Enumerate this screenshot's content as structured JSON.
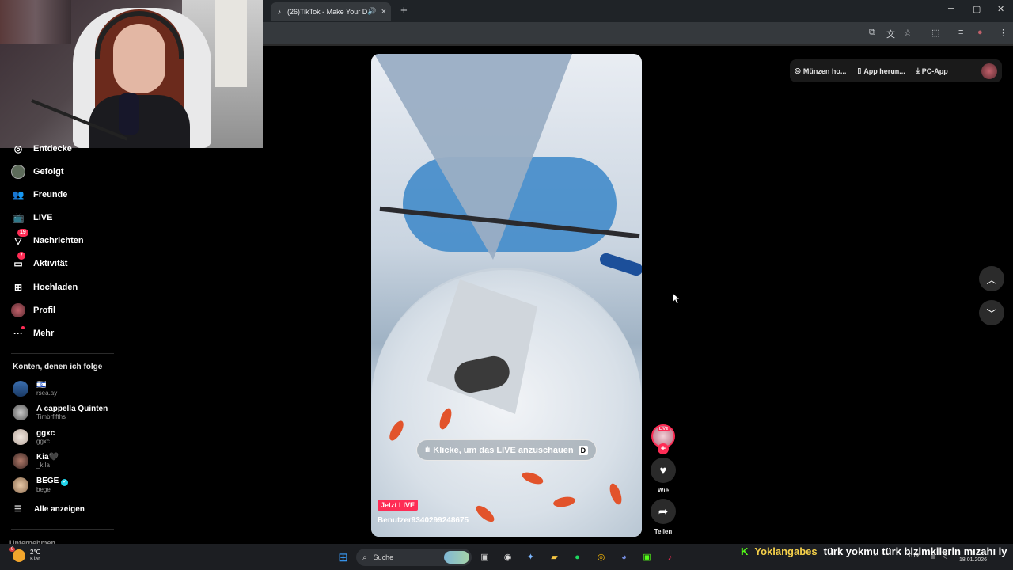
{
  "browser": {
    "tab_title": "(26)TikTok - Make Your Day",
    "new_tab": "+",
    "close_tab": "×",
    "min": "─",
    "max": "▢",
    "close": "✕"
  },
  "sidebar": {
    "items": [
      {
        "label": "Entdecke",
        "icon": "compass-icon"
      },
      {
        "label": "Gefolgt",
        "icon": "following-avatar-icon"
      },
      {
        "label": "Freunde",
        "icon": "friends-icon"
      },
      {
        "label": "LIVE",
        "icon": "live-tv-icon"
      },
      {
        "label": "Nachrichten",
        "icon": "messages-icon",
        "badge": "19"
      },
      {
        "label": "Aktivität",
        "icon": "activity-icon",
        "badge": "7"
      },
      {
        "label": "Hochladen",
        "icon": "upload-icon"
      },
      {
        "label": "Profil",
        "icon": "profile-avatar-icon"
      },
      {
        "label": "Mehr",
        "icon": "more-icon"
      }
    ],
    "following_heading": "Konten, denen ich folge",
    "accounts": [
      {
        "name": "🇮🇱",
        "handle": "rsea.ay"
      },
      {
        "name": "A cappella Quinten",
        "handle": "Timbrfifths"
      },
      {
        "name": "ggxc",
        "handle": "ggxc"
      },
      {
        "name": "Kia🖤",
        "handle": "_k.la"
      },
      {
        "name": "BEGE",
        "handle": "bege",
        "verified": true
      }
    ],
    "show_all": "Alle anzeigen",
    "truncated_section": "Unternehmen"
  },
  "top_actions": {
    "coins": "Münzen ho...",
    "app": "App herun...",
    "pc_app": "PC-App"
  },
  "video": {
    "live_prompt": "Klicke, um das LIVE anzuschauen",
    "live_key": "D",
    "now_live": "Jetzt LIVE",
    "username": "Benutzer9340299248675"
  },
  "rail": {
    "live_tag": "LIVE",
    "like_label": "Wie",
    "share_label": "Teilen"
  },
  "taskbar": {
    "temp": "2°C",
    "condition": "Klar",
    "weather_badge": "9",
    "search_placeholder": "Suche",
    "lang": "TUR",
    "date": "18.01.2026"
  },
  "chat_ticker": {
    "platform_icon": "K",
    "user": "Yoklangabes",
    "message": "türk yokmu türk bizimkilerin mızahı iy"
  },
  "colors": {
    "accent": "#fe2c55",
    "verified": "#20d5ec",
    "kick_green": "#53fc18",
    "chat_user": "#f5d04a"
  }
}
